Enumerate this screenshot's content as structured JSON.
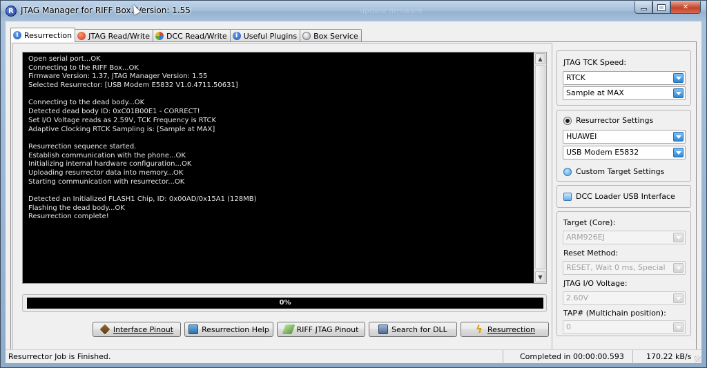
{
  "window": {
    "title": "JTAG Manager for RIFF Box. Version: 1.55",
    "title_glow_text": "update firmware",
    "app_icon": "R"
  },
  "tabs": [
    {
      "label": "Resurrection",
      "icon": "info-icon",
      "active": true
    },
    {
      "label": "JTAG Read/Write",
      "icon": "jtag-icon",
      "active": false
    },
    {
      "label": "DCC Read/Write",
      "icon": "dcc-icon",
      "active": false
    },
    {
      "label": "Useful Plugins",
      "icon": "info-icon",
      "active": false
    },
    {
      "label": "Box Service",
      "icon": "box-icon",
      "active": false
    }
  ],
  "console": {
    "lines": [
      "Open serial port...OK",
      "Connecting to the RIFF Box...OK",
      "Firmware Version: 1.37, JTAG Manager Version: 1.55",
      "Selected Resurrector: [USB Modem E5832 V1.0.4711.50631]",
      "",
      "Connecting to the dead body...OK",
      "Detected dead body ID: 0xC01B00E1 - CORRECT!",
      "Set I/O Voltage reads as 2.59V, TCK Frequency is RTCK",
      "Adaptive Clocking RTCK Sampling is: [Sample at MAX]",
      "",
      "Resurrection sequence started.",
      "Establish communication with the phone...OK",
      "Initializing internal hardware configuration...OK",
      "Uploading resurrector data into memory...OK",
      "Starting communication with resurrector...OK",
      "",
      "Detected an Initialized FLASH1 Chip, ID: 0x00AD/0x15A1 (128MB)",
      "Flashing the dead body...OK",
      "Resurrection complete!"
    ]
  },
  "progress": {
    "label": "0%",
    "value": 0
  },
  "buttons": [
    {
      "label": "Interface Pinout",
      "icon": "cube-icon"
    },
    {
      "label": "Resurrection Help",
      "icon": "help-book-icon"
    },
    {
      "label": "RIFF JTAG Pinout",
      "icon": "pinout-icon"
    },
    {
      "label": "Search for DLL",
      "icon": "dll-search-icon"
    },
    {
      "label": "Resurrection",
      "icon": "lightning-icon"
    }
  ],
  "right_panel": {
    "tck_group": {
      "title": "JTAG TCK Speed:",
      "speed_value": "RTCK",
      "sampling_value": "Sample at MAX"
    },
    "resurrector_group": {
      "radio_label": "Resurrector Settings",
      "radio_checked": true,
      "manufacturer_value": "HUAWEI",
      "model_value": "USB Modem E5832",
      "custom_label": "Custom Target Settings"
    },
    "dcc_group": {
      "label": "DCC Loader USB Interface"
    },
    "target_group": {
      "core_label": "Target (Core):",
      "core_value": "ARM926EJ",
      "reset_label": "Reset Method:",
      "reset_value": "RESET, Wait 0 ms, Special",
      "voltage_label": "JTAG I/O Voltage:",
      "voltage_value": "2.60V",
      "tap_label": "TAP# (Multichain position):",
      "tap_value": "0"
    }
  },
  "statusbar": {
    "message": "Resurrector Job is Finished.",
    "completed": "Completed in 00:00:00.593",
    "speed": "170.22 kB/s"
  },
  "colors": {
    "console_bg": "#000000",
    "console_text": "#e6e6e6",
    "combo_drop_accent": "#2c88d6",
    "close_button": "#c2442a"
  }
}
